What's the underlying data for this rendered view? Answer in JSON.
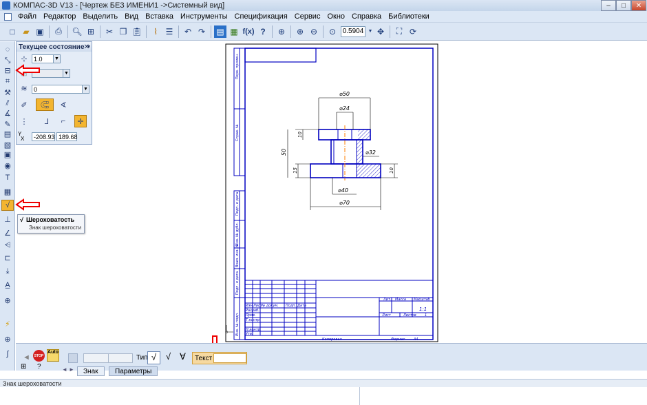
{
  "window": {
    "title": "КОМПАС-3D V13 - [Чертеж БЕЗ ИМЕНИ1 ->Системный вид]",
    "minimize": "–",
    "maximize": "□",
    "close": "✕"
  },
  "menu": [
    "Файл",
    "Редактор",
    "Выделить",
    "Вид",
    "Вставка",
    "Инструменты",
    "Спецификация",
    "Сервис",
    "Окно",
    "Справка",
    "Библиотеки"
  ],
  "toolbar": {
    "zoom_value": "0.5904",
    "fx_label": "f(x)"
  },
  "state_panel": {
    "title": "Текущее состояние",
    "step_value": "1.0",
    "layer_value": "0",
    "coord_x": "-208.93",
    "coord_y": "189.68",
    "coord_label_x": "X",
    "coord_label_y": "Y"
  },
  "tooltip": {
    "title": "Шероховатость",
    "description": "Знак шероховатости"
  },
  "property_bar": {
    "type_label": "Тип",
    "text_label": "Текст",
    "text_value": "",
    "stop_label": "STOP",
    "auto_label": "Auto",
    "tabs": [
      "Знак",
      "Параметры"
    ]
  },
  "status": {
    "text": "Знак шероховатости"
  },
  "drawing": {
    "dims": {
      "d50": "⌀50",
      "d24": "⌀24",
      "d32": "⌀32",
      "d40": "⌀40",
      "d70": "⌀70",
      "h50": "50",
      "h10a": "10",
      "h15": "15",
      "h10b": "10"
    },
    "side_labels": [
      "Перв. примен.",
      "Справ. №",
      "Подп. и дата",
      "Инв. № дубл.",
      "Взам. инв. №",
      "Подп. и дата",
      "Инв. № подл."
    ],
    "title_block": {
      "col_izm": "Изм",
      "col_list": "Лист",
      "col_ndokum": "№ докум.",
      "col_podp": "Подп.",
      "col_data": "Дата",
      "row_razrab": "Разраб.",
      "row_prov": "Пров.",
      "row_tkontr": "Т.контр.",
      "row_nkontr": "Н.контр.",
      "row_utv": "Утв.",
      "lit": "Лит.",
      "massa": "Масса",
      "masshtab": "Масштаб",
      "scale_value": "1:1",
      "list_label": "Лист",
      "listov_label": "Листов",
      "listov_value": "1",
      "kopiroval": "Копировал",
      "format": "Формат",
      "format_value": "A4"
    }
  }
}
